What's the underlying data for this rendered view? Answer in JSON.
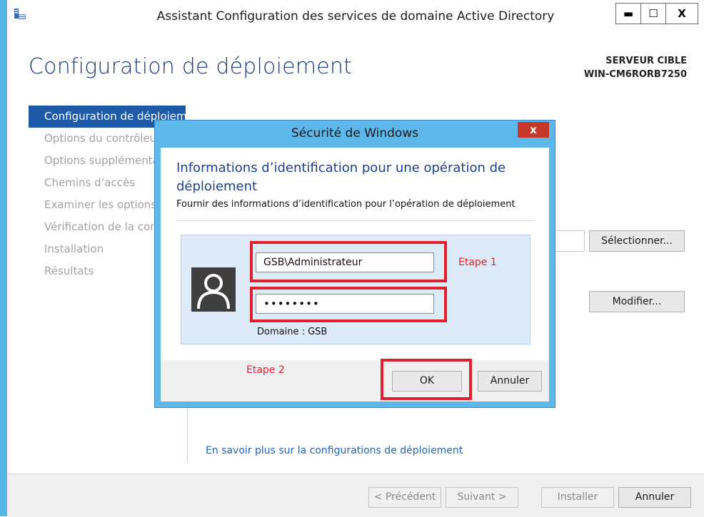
{
  "window": {
    "title": "Assistant Configuration des services de domaine Active Directory",
    "minimize": "▬",
    "maximize": "☐",
    "close": "X"
  },
  "page": {
    "title": "Configuration de déploiement",
    "target_label": "SERVEUR CIBLE",
    "target_name": "WIN-CM6RORB7250"
  },
  "nav": {
    "items": [
      {
        "label": "Configuration de déploiement"
      },
      {
        "label": "Options du contrôleur de domaine"
      },
      {
        "label": "Options supplémentaires"
      },
      {
        "label": "Chemins d’accès"
      },
      {
        "label": "Examiner les options"
      },
      {
        "label": "Vérification de la configuration requise"
      },
      {
        "label": "Installation"
      },
      {
        "label": "Résultats"
      }
    ]
  },
  "content": {
    "select_label": "Sélectionner...",
    "modify_label": "Modifier...",
    "learn_more": "En savoir plus sur la configurations de déploiement"
  },
  "footer": {
    "previous": "< Précédent",
    "next": "Suivant >",
    "install": "Installer",
    "cancel": "Annuler"
  },
  "dialog": {
    "title": "Sécurité de Windows",
    "close": "x",
    "heading": "Informations d’identification pour une opération de déploiement",
    "subheading": "Fournir des informations d’identification pour l’opération de déploiement",
    "username": "GSB\\Administrateur",
    "password": "••••••••",
    "domain": "Domaine : GSB",
    "step1": "Etape 1",
    "step2": "Etape 2",
    "ok": "OK",
    "cancel": "Annuler"
  }
}
